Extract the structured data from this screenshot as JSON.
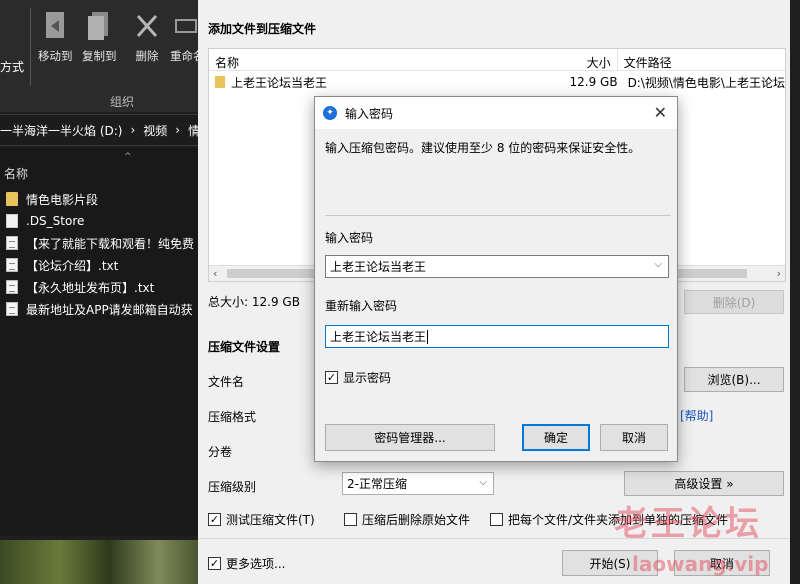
{
  "explorer": {
    "ribbon_left_label": "方式",
    "buttons": [
      {
        "label": "移动到",
        "icon": "move-to-icon"
      },
      {
        "label": "复制到",
        "icon": "copy-to-icon"
      },
      {
        "label": "删除",
        "icon": "delete-icon"
      },
      {
        "label": "重命名",
        "icon": "rename-icon"
      }
    ],
    "group_label": "组织",
    "breadcrumb": [
      "一半海洋一半火焰 (D:)",
      "视频",
      "情"
    ],
    "column_name": "名称",
    "items": [
      {
        "name": "情色电影片段",
        "type": "folder"
      },
      {
        "name": ".DS_Store",
        "type": "file"
      },
      {
        "name": "【来了就能下载和观看！纯免费",
        "type": "txt"
      },
      {
        "name": "【论坛介绍】.txt",
        "type": "txt"
      },
      {
        "name": "【永久地址发布页】.txt",
        "type": "txt"
      },
      {
        "name": "最新地址及APP请发邮箱自动获",
        "type": "txt"
      }
    ]
  },
  "compress": {
    "title": "添加文件到压缩文件",
    "col_name": "名称",
    "col_size": "大小",
    "col_path": "文件路径",
    "rows": [
      {
        "name": "上老王论坛当老王",
        "size": "12.9 GB",
        "path": "D:\\视频\\情色电影\\上老王论坛"
      }
    ],
    "total_size": "总大小: 12.9 GB",
    "delete_button": "删除(D)",
    "settings_title": "压缩文件设置",
    "filename_label": "文件名",
    "browse_button": "浏览(B)...",
    "format_label": "压缩格式",
    "help_link": "[帮助]",
    "volume_label": "分卷",
    "level_label": "压缩级别",
    "level_value": "2-正常压缩",
    "advanced_button": "高级设置 »",
    "options": [
      {
        "label": "测试压缩文件(T)",
        "checked": true
      },
      {
        "label": "压缩后删除原始文件",
        "checked": false
      },
      {
        "label": "把每个文件/文件夹添加到单独的压缩文件",
        "checked": false
      }
    ],
    "more_options": {
      "label": "更多选项...",
      "checked": true
    },
    "start_button": "开始(S)",
    "cancel_button": "取消"
  },
  "password_dialog": {
    "title": "输入密码",
    "description": "输入压缩包密码。建议使用至少 8 位的密码来保证安全性。",
    "password_label": "输入密码",
    "password_value": "上老王论坛当老王",
    "reenter_label": "重新输入密码",
    "reenter_value": "上老王论坛当老王",
    "show_password": {
      "label": "显示密码",
      "checked": true
    },
    "manager_button": "密码管理器...",
    "ok_button": "确定",
    "cancel_button": "取消"
  },
  "watermark": {
    "line1": "老王论坛",
    "line2": "laowang.vip"
  },
  "colors": {
    "accent": "#0078d7",
    "dark_bg": "#191919",
    "folder": "#e8c25a",
    "watermark": "#e14b5f"
  }
}
